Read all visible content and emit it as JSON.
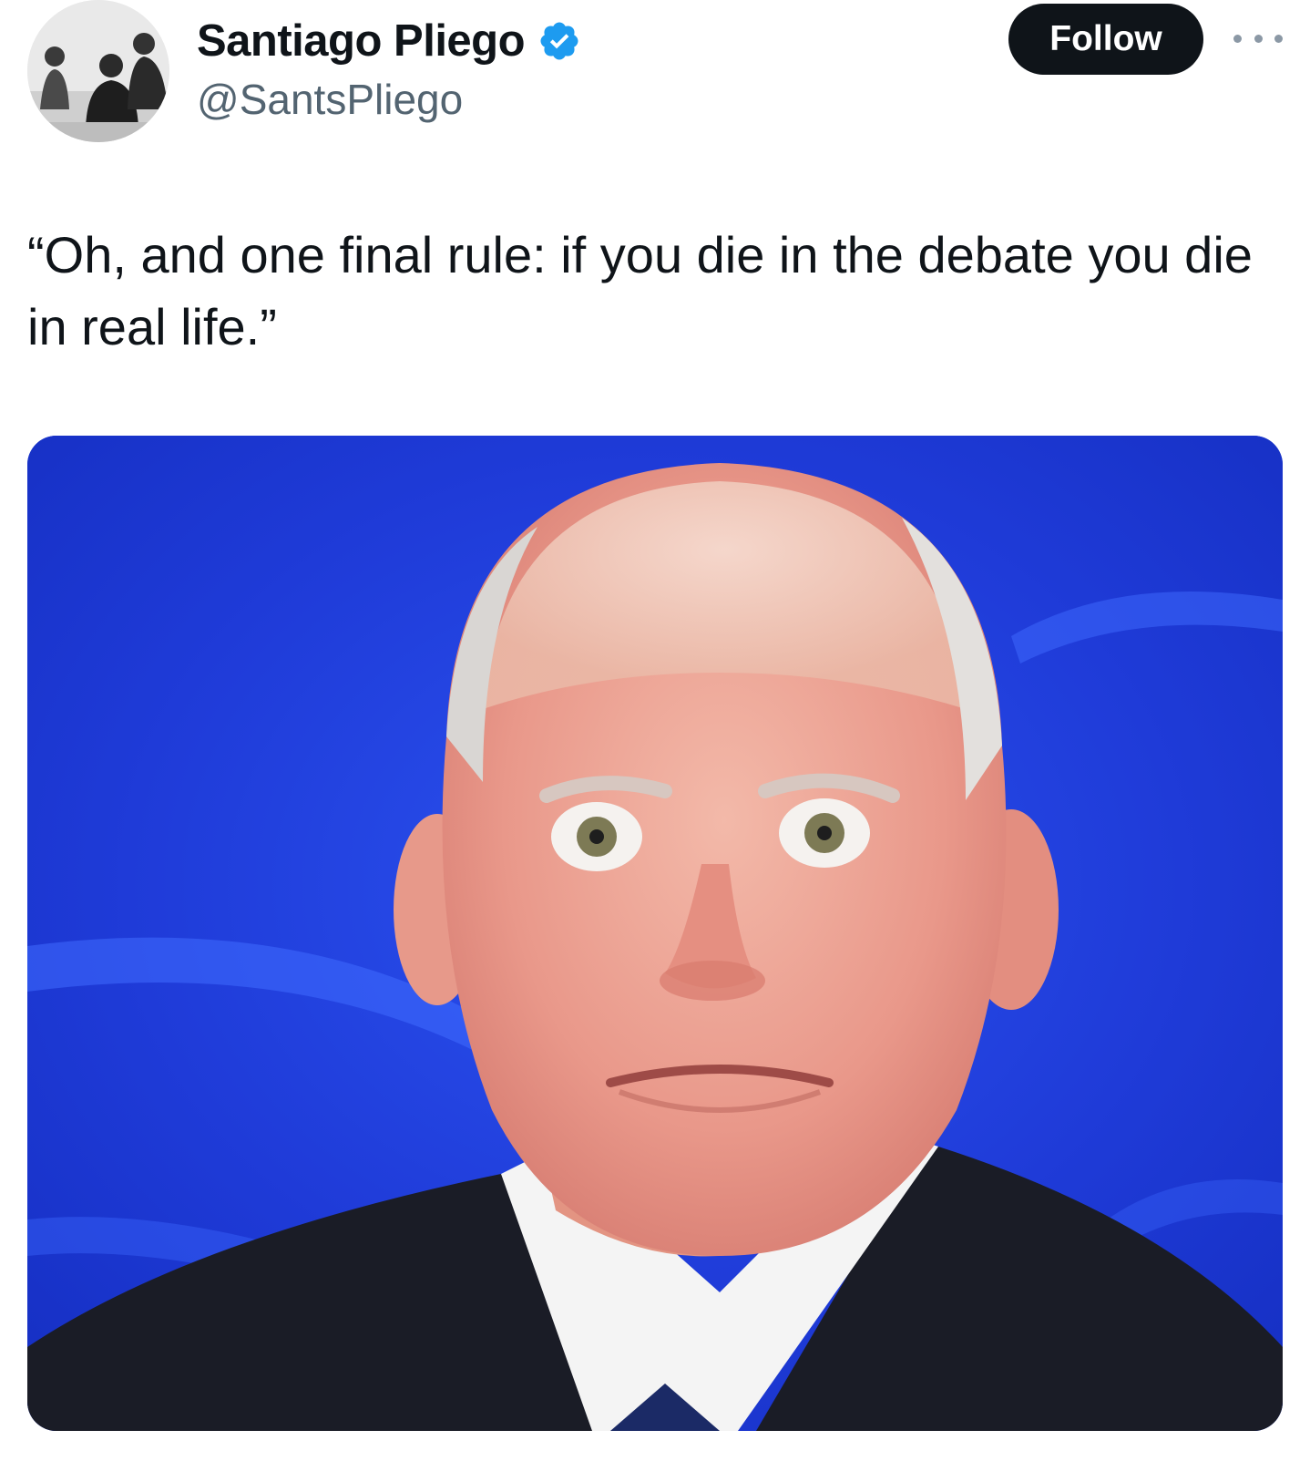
{
  "author": {
    "display_name": "Santiago Pliego",
    "handle": "@SantsPliego",
    "verified": true,
    "avatar_icon": "group-photo-avatar"
  },
  "actions": {
    "follow_label": "Follow",
    "more_icon": "more-options-icon"
  },
  "tweet": {
    "text": "“Oh, and one final rule: if you die in the debate you die in real life.”"
  },
  "media": {
    "description_icon": "photo-man-wide-eyed"
  },
  "colors": {
    "text_primary": "#0f1419",
    "text_secondary": "#536471",
    "verified_blue": "#1d9bf0",
    "follow_bg": "#0f1419",
    "photo_background_blue": "#1f3bd8"
  }
}
